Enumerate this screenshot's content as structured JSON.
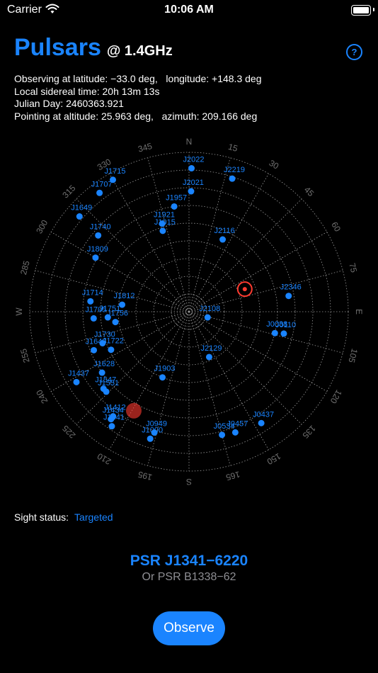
{
  "status_bar": {
    "carrier": "Carrier",
    "time": "10:06 AM",
    "wifi_icon": "wifi-icon",
    "battery_icon": "battery-icon"
  },
  "header": {
    "title": "Pulsars",
    "frequency": "@ 1.4GHz",
    "help_icon": "?"
  },
  "info": {
    "line1": "Observing at latitude: −33.0 deg,   longitude: +148.3 deg",
    "line2": "Local sidereal time: 20h 13m 13s",
    "line3": "Julian Day: 2460363.921",
    "line4": "Pointing at altitude: 25.963 deg,   azimuth: 209.166 deg"
  },
  "sky_map": {
    "compass": [
      "N",
      "E",
      "S",
      "W"
    ],
    "azimuth_labels": [
      "15",
      "30",
      "45",
      "60",
      "75",
      "105",
      "120",
      "135",
      "150",
      "165",
      "195",
      "210",
      "225",
      "240",
      "255",
      "285",
      "300",
      "315",
      "330",
      "345"
    ],
    "pointing": {
      "altitude": 25.963,
      "azimuth": 209.166
    },
    "colors": {
      "pulsar": "#1a84ff",
      "pointer": "#ff3b30",
      "grid": "#9a9a9a"
    },
    "pulsars": [
      {
        "name": "J2022",
        "alt": 9,
        "az": 1
      },
      {
        "name": "J2219",
        "alt": 11,
        "az": 18
      },
      {
        "name": "J1715",
        "alt": 4,
        "az": 330
      },
      {
        "name": "J1707",
        "alt": 6,
        "az": 323
      },
      {
        "name": "J1649",
        "alt": 8,
        "az": 311
      },
      {
        "name": "J1740",
        "alt": 23,
        "az": 310
      },
      {
        "name": "J1809",
        "alt": 29,
        "az": 300
      },
      {
        "name": "J1957",
        "alt": 30,
        "az": 352
      },
      {
        "name": "J2021",
        "alt": 22,
        "az": 1
      },
      {
        "name": "J1921",
        "alt": 38,
        "az": 343
      },
      {
        "name": "J1915",
        "alt": 42,
        "az": 342
      },
      {
        "name": "J2116",
        "alt": 45,
        "az": 25
      },
      {
        "name": "J2346",
        "alt": 33,
        "az": 81
      },
      {
        "name": "J0038",
        "alt": 40,
        "az": 104
      },
      {
        "name": "J0110",
        "alt": 35,
        "az": 103
      },
      {
        "name": "J2108",
        "alt": 79,
        "az": 107
      },
      {
        "name": "J2129",
        "alt": 62,
        "az": 156
      },
      {
        "name": "J1903",
        "alt": 50,
        "az": 202
      },
      {
        "name": "J1812",
        "alt": 52,
        "az": 276
      },
      {
        "name": "J1714",
        "alt": 34,
        "az": 276
      },
      {
        "name": "J1705",
        "alt": 36,
        "az": 266
      },
      {
        "name": "J1751",
        "alt": 44,
        "az": 266
      },
      {
        "name": "J1756",
        "alt": 48,
        "az": 262
      },
      {
        "name": "J1730",
        "alt": 38,
        "az": 250
      },
      {
        "name": "J1645",
        "alt": 32,
        "az": 248
      },
      {
        "name": "J1722",
        "alt": 41,
        "az": 244
      },
      {
        "name": "J1628",
        "alt": 30,
        "az": 235
      },
      {
        "name": "J1437",
        "alt": 15,
        "az": 238
      },
      {
        "name": "J1547",
        "alt": 25,
        "az": 228
      },
      {
        "name": "J1551",
        "alt": 25,
        "az": 226
      },
      {
        "name": "J1412",
        "alt": 17,
        "az": 216
      },
      {
        "name": "J1434",
        "alt": 15,
        "az": 216
      },
      {
        "name": "J1341",
        "alt": 12,
        "az": 214
      },
      {
        "name": "J0949",
        "alt": 19,
        "az": 196
      },
      {
        "name": "J1000",
        "alt": 15,
        "az": 197
      },
      {
        "name": "J0534",
        "alt": 18,
        "az": 165
      },
      {
        "name": "J0457",
        "alt": 17,
        "az": 159
      },
      {
        "name": "J0437",
        "alt": 15,
        "az": 147
      }
    ],
    "target_marker_az": 68,
    "target_marker_alt": 56
  },
  "sight": {
    "label": "Sight status:",
    "value": "Targeted"
  },
  "pulsar": {
    "name": "PSR J1341−6220",
    "alt_name": "Or PSR B1338−62"
  },
  "observe_button": {
    "label": "Observe"
  }
}
